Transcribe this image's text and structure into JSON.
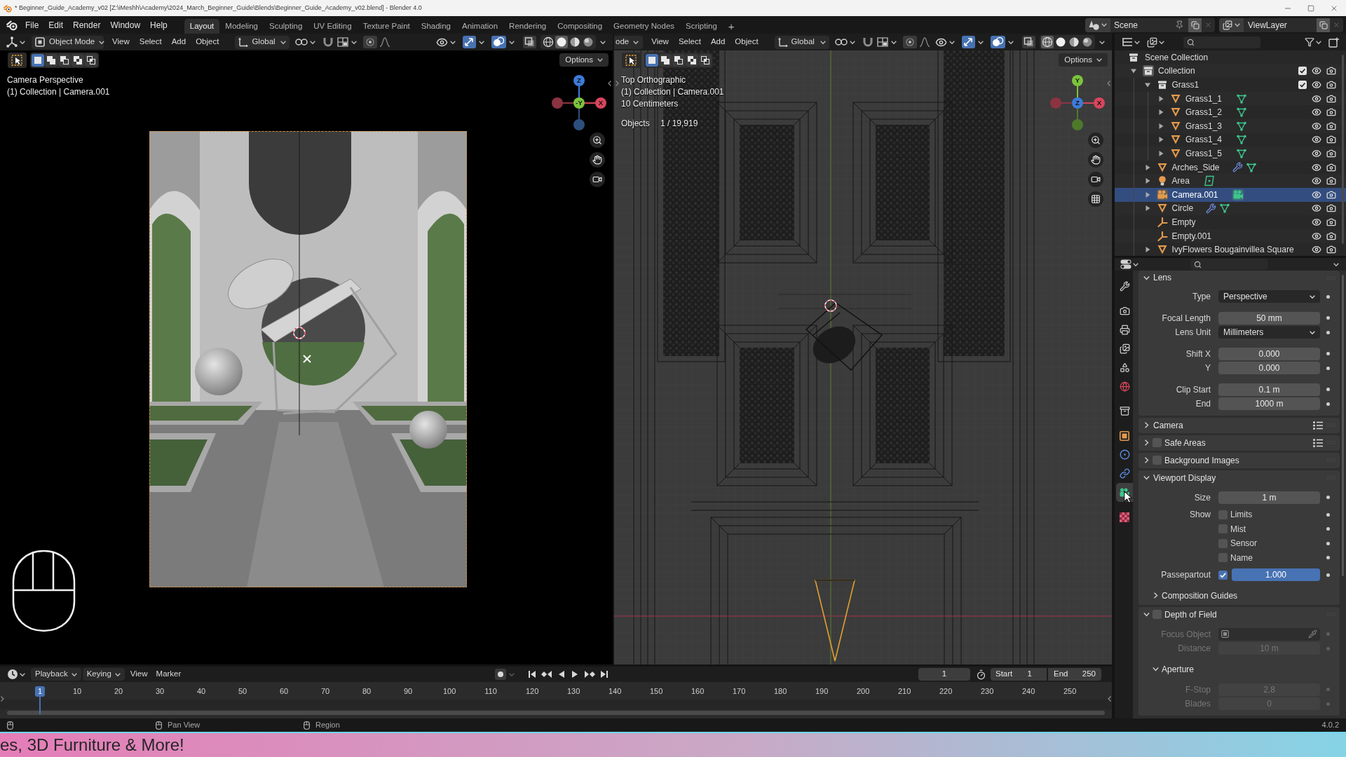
{
  "window": {
    "title": "* Beginner_Guide_Academy_v02 [Z:\\iMeshh\\Academy\\2024_March_Beginner_Guide\\Blends\\Beginner_Guide_Academy_v02.blend] - Blender 4.0"
  },
  "menu": [
    "File",
    "Edit",
    "Render",
    "Window",
    "Help"
  ],
  "workspaces": [
    {
      "label": "Layout",
      "selected": true
    },
    {
      "label": "Modeling",
      "selected": false
    },
    {
      "label": "Sculpting",
      "selected": false
    },
    {
      "label": "UV Editing",
      "selected": false
    },
    {
      "label": "Texture Paint",
      "selected": false
    },
    {
      "label": "Shading",
      "selected": false
    },
    {
      "label": "Animation",
      "selected": false
    },
    {
      "label": "Rendering",
      "selected": false
    },
    {
      "label": "Compositing",
      "selected": false
    },
    {
      "label": "Geometry Nodes",
      "selected": false
    },
    {
      "label": "Scripting",
      "selected": false
    }
  ],
  "add_workspace": "+",
  "scene": "Scene",
  "view_layer": "ViewLayer",
  "viewports": [
    {
      "kind": "camera",
      "mode": "Object Mode",
      "menus": [
        "View",
        "Select",
        "Add",
        "Object"
      ],
      "orientation": "Global",
      "snapping": false,
      "proportional": false,
      "gizmos": true,
      "overlays": true,
      "xray": false,
      "shading": [
        {
          "kind": "wireframe",
          "selected": false
        },
        {
          "kind": "solid",
          "selected": true
        },
        {
          "kind": "material",
          "selected": false
        },
        {
          "kind": "rendered",
          "selected": false
        }
      ],
      "select_modes": [
        {
          "kind": "set",
          "selected": true
        },
        {
          "kind": "extend",
          "selected": false
        },
        {
          "kind": "subtract",
          "selected": false
        },
        {
          "kind": "invert",
          "selected": false
        },
        {
          "kind": "intersect",
          "selected": false
        }
      ],
      "options": "Options",
      "info": [
        "Camera Perspective",
        "(1) Collection | Camera.001"
      ],
      "gizmo": [
        {
          "label": "Z",
          "color": "#3d7bd9"
        },
        {
          "label": "-Y",
          "color": "#7cc33d"
        },
        {
          "label": "X",
          "color": "#d8455c"
        },
        {
          "color": "#8c3342"
        },
        {
          "color": "#2d4f7d"
        }
      ]
    },
    {
      "kind": "top",
      "mode": "ode",
      "menus": [
        "View",
        "Select",
        "Add",
        "Object"
      ],
      "orientation": "Global",
      "snapping": false,
      "proportional": false,
      "gizmos": true,
      "overlays": true,
      "xray": false,
      "shading": [
        {
          "kind": "wireframe",
          "selected": true
        },
        {
          "kind": "solid",
          "selected": false
        },
        {
          "kind": "material",
          "selected": false
        },
        {
          "kind": "rendered",
          "selected": false
        }
      ],
      "select_modes": [
        {
          "kind": "set",
          "selected": true
        },
        {
          "kind": "extend",
          "selected": false
        },
        {
          "kind": "subtract",
          "selected": false
        },
        {
          "kind": "invert",
          "selected": false
        },
        {
          "kind": "intersect",
          "selected": false
        }
      ],
      "options": "Options",
      "info": [
        "Top Orthographic",
        "(1) Collection | Camera.001",
        "10 Centimeters"
      ],
      "stats": {
        "label": "Objects",
        "value": "1 / 19,919"
      },
      "gizmo": [
        {
          "label": "Y",
          "color": "#7cc33d"
        },
        {
          "label": "Z",
          "color": "#3d7bd9"
        },
        {
          "label": "X",
          "color": "#d8455c"
        },
        {
          "color": "#8c3342"
        },
        {
          "color": "#4d7a2a"
        }
      ]
    }
  ],
  "outliner": {
    "items": [
      {
        "name": "Scene Collection",
        "kind": "scene_collection",
        "selected": false,
        "active": false,
        "children": [
          {
            "name": "Collection",
            "kind": "collection",
            "expanded": true,
            "selected": false,
            "active": true,
            "checked": true,
            "visible": true,
            "renderable": true,
            "children": [
              {
                "name": "Grass1",
                "kind": "collection",
                "expanded": true,
                "selected": false,
                "active": false,
                "checked": true,
                "visible": true,
                "renderable": true,
                "children": [
                  {
                    "name": "Grass1_1",
                    "kind": "mesh",
                    "expanded": false,
                    "selected": false,
                    "active": false,
                    "modifiers": false,
                    "data": true,
                    "visible": true,
                    "renderable": true
                  },
                  {
                    "name": "Grass1_2",
                    "kind": "mesh",
                    "expanded": false,
                    "selected": false,
                    "active": false,
                    "modifiers": false,
                    "data": true,
                    "visible": true,
                    "renderable": true
                  },
                  {
                    "name": "Grass1_3",
                    "kind": "mesh",
                    "expanded": false,
                    "selected": false,
                    "active": false,
                    "modifiers": false,
                    "data": true,
                    "visible": true,
                    "renderable": true
                  },
                  {
                    "name": "Grass1_4",
                    "kind": "mesh",
                    "expanded": false,
                    "selected": false,
                    "active": false,
                    "modifiers": false,
                    "data": true,
                    "visible": true,
                    "renderable": true
                  },
                  {
                    "name": "Grass1_5",
                    "kind": "mesh",
                    "expanded": false,
                    "selected": false,
                    "active": false,
                    "modifiers": false,
                    "data": true,
                    "visible": true,
                    "renderable": true
                  }
                ]
              },
              {
                "name": "Arches_Side",
                "kind": "mesh",
                "expanded": false,
                "selected": false,
                "active": false,
                "modifiers": true,
                "data": true,
                "visible": true,
                "renderable": true
              },
              {
                "name": "Area",
                "kind": "light",
                "expanded": false,
                "selected": false,
                "active": false,
                "modifiers": false,
                "data": true,
                "visible": true,
                "renderable": true
              },
              {
                "name": "Camera.001",
                "kind": "camera",
                "expanded": false,
                "selected": true,
                "active": true,
                "modifiers": false,
                "data": true,
                "visible": true,
                "renderable": true
              },
              {
                "name": "Circle",
                "kind": "mesh",
                "expanded": false,
                "selected": false,
                "active": false,
                "modifiers": true,
                "data": true,
                "visible": true,
                "renderable": true
              },
              {
                "name": "Empty",
                "kind": "empty",
                "selected": false,
                "active": false,
                "visible": true,
                "renderable": true
              },
              {
                "name": "Empty.001",
                "kind": "empty",
                "selected": false,
                "active": false,
                "visible": true,
                "renderable": true
              },
              {
                "name": "IvyFlowers Bougainvillea Square",
                "kind": "mesh",
                "expanded": false,
                "selected": false,
                "active": false,
                "modifiers": false,
                "data": false,
                "visible": true,
                "renderable": true
              }
            ]
          }
        ]
      }
    ]
  },
  "properties": {
    "tabs": [
      [
        {
          "kind": "tool",
          "selected": false
        }
      ],
      [
        {
          "kind": "render",
          "selected": false
        },
        {
          "kind": "output",
          "selected": false
        },
        {
          "kind": "view_layer",
          "selected": false
        },
        {
          "kind": "scene",
          "selected": false
        },
        {
          "kind": "world",
          "selected": false
        }
      ],
      [
        {
          "kind": "collection",
          "selected": false
        }
      ],
      [
        {
          "kind": "object",
          "selected": false
        },
        {
          "kind": "physics",
          "selected": false
        },
        {
          "kind": "constraints",
          "selected": false
        },
        {
          "kind": "data",
          "selected": true
        }
      ],
      [
        {
          "kind": "texture",
          "selected": false
        }
      ]
    ],
    "panels": [
      {
        "title": "Lens",
        "expanded": true,
        "presets": false,
        "groups": [
          [
            {
              "kind": "dropdown",
              "label": "Type",
              "value": "Perspective",
              "disabled": false
            }
          ],
          [
            {
              "kind": "number",
              "label": "Focal Length",
              "value": "50 mm",
              "disabled": false
            },
            {
              "kind": "dropdown",
              "label": "Lens Unit",
              "value": "Millimeters",
              "disabled": false
            }
          ],
          [
            {
              "kind": "number",
              "label": "Shift X",
              "value": "0.000",
              "disabled": false
            },
            {
              "kind": "number",
              "label": "Y",
              "value": "0.000",
              "disabled": false
            }
          ],
          [
            {
              "kind": "number",
              "label": "Clip Start",
              "value": "0.1 m",
              "disabled": false
            },
            {
              "kind": "number",
              "label": "End",
              "value": "1000 m",
              "disabled": false
            }
          ]
        ]
      },
      {
        "title": "Camera",
        "expanded": false,
        "presets": true
      },
      {
        "title": "Safe Areas",
        "expanded": false,
        "checked": false,
        "presets": true
      },
      {
        "title": "Background Images",
        "expanded": false,
        "checked": false,
        "presets": false
      },
      {
        "title": "Viewport Display",
        "expanded": true,
        "presets": false,
        "groups": [
          [
            {
              "kind": "number",
              "label": "Size",
              "value": "1 m",
              "disabled": false
            }
          ],
          [
            {
              "kind": "checkbox",
              "label": "Show",
              "text": "Limits",
              "checked": false,
              "disabled": false
            },
            {
              "kind": "checkbox",
              "text": "Mist",
              "checked": false,
              "disabled": false
            },
            {
              "kind": "checkbox",
              "text": "Sensor",
              "checked": false,
              "disabled": false
            },
            {
              "kind": "checkbox",
              "text": "Name",
              "checked": false,
              "disabled": false
            }
          ],
          [
            {
              "kind": "toggle_slider",
              "label": "Passepartout",
              "checked": true,
              "value": "1.000",
              "level": 1,
              "disabled": false
            }
          ]
        ],
        "subpanels": [
          {
            "title": "Composition Guides",
            "expanded": false
          }
        ]
      },
      {
        "title": "Depth of Field",
        "expanded": true,
        "checked": false,
        "presets": false,
        "groups": [
          [
            {
              "kind": "object",
              "label": "Focus Object",
              "disabled": true
            },
            {
              "kind": "number",
              "label": "Distance",
              "value": "10 m",
              "disabled": true
            }
          ]
        ],
        "subpanels": [
          {
            "title": "Aperture",
            "expanded": true,
            "groups": [
              [
                {
                  "kind": "number",
                  "label": "F-Stop",
                  "value": "2.8",
                  "disabled": true
                },
                {
                  "kind": "number",
                  "label": "Blades",
                  "value": "0",
                  "disabled": true
                }
              ]
            ]
          }
        ]
      }
    ]
  },
  "timeline": {
    "menus": [
      {
        "label": "Playback",
        "dropdown": true
      },
      {
        "label": "Keying",
        "dropdown": true
      },
      {
        "label": "View",
        "dropdown": false
      },
      {
        "label": "Marker",
        "dropdown": false
      }
    ],
    "auto_key": false,
    "current_frame": "1",
    "start_label": "Start",
    "start": "1",
    "end_label": "End",
    "end": "250",
    "ruler": [
      {
        "label": "1",
        "selected": true
      },
      {
        "label": "10",
        "selected": false
      },
      {
        "label": "20",
        "selected": false
      },
      {
        "label": "30",
        "selected": false
      },
      {
        "label": "40",
        "selected": false
      },
      {
        "label": "50",
        "selected": false
      },
      {
        "label": "60",
        "selected": false
      },
      {
        "label": "70",
        "selected": false
      },
      {
        "label": "80",
        "selected": false
      },
      {
        "label": "90",
        "selected": false
      },
      {
        "label": "100",
        "selected": false
      },
      {
        "label": "110",
        "selected": false
      },
      {
        "label": "120",
        "selected": false
      },
      {
        "label": "130",
        "selected": false
      },
      {
        "label": "140",
        "selected": false
      },
      {
        "label": "150",
        "selected": false
      },
      {
        "label": "160",
        "selected": false
      },
      {
        "label": "170",
        "selected": false
      },
      {
        "label": "180",
        "selected": false
      },
      {
        "label": "190",
        "selected": false
      },
      {
        "label": "200",
        "selected": false
      },
      {
        "label": "210",
        "selected": false
      },
      {
        "label": "220",
        "selected": false
      },
      {
        "label": "230",
        "selected": false
      },
      {
        "label": "240",
        "selected": false
      },
      {
        "label": "250",
        "selected": false
      }
    ]
  },
  "status": {
    "hints": [
      "Pan View",
      "Region"
    ],
    "version": "4.0.2"
  },
  "banner": "es, 3D Furniture & More!"
}
